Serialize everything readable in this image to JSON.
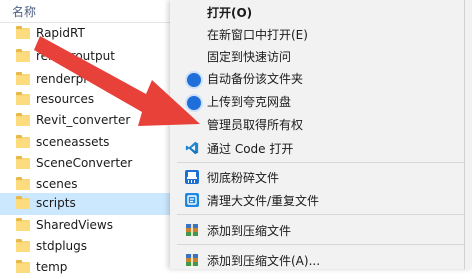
{
  "explorer": {
    "column_header": "名称",
    "files": [
      {
        "name": "RapidRT",
        "selected": false
      },
      {
        "name": "renderoutput",
        "selected": false
      },
      {
        "name": "renderpl",
        "selected": false
      },
      {
        "name": "resources",
        "selected": false
      },
      {
        "name": "Revit_converter",
        "selected": false
      },
      {
        "name": "sceneassets",
        "selected": false
      },
      {
        "name": "SceneConverter",
        "selected": false
      },
      {
        "name": "scenes",
        "selected": false
      },
      {
        "name": "scripts",
        "selected": true
      },
      {
        "name": "SharedViews",
        "selected": false
      },
      {
        "name": "stdplugs",
        "selected": false
      },
      {
        "name": "temp",
        "selected": false
      }
    ]
  },
  "context_menu": {
    "items": [
      {
        "label": "打开(O)",
        "icon": "none",
        "bold": true
      },
      {
        "label": "在新窗口中打开(E)",
        "icon": "none"
      },
      {
        "label": "固定到快速访问",
        "icon": "none"
      },
      {
        "label": "自动备份该文件夹",
        "icon": "baidu-backup-icon"
      },
      {
        "label": "上传到夸克网盘",
        "icon": "quark-upload-icon"
      },
      {
        "label": "管理员取得所有权",
        "icon": "none"
      },
      {
        "label": "通过 Code 打开",
        "icon": "vscode-icon"
      },
      {
        "label": "彻底粉碎文件",
        "icon": "shredder-icon"
      },
      {
        "label": "清理大文件/重复文件",
        "icon": "cleanup-icon"
      },
      {
        "label": "添加到压缩文件",
        "icon": "archive-icon"
      },
      {
        "label": "添加到压缩文件(A)...",
        "icon": "archive-icon"
      }
    ]
  },
  "colors": {
    "selection": "#cce8ff",
    "menu_background": "#f2f2f2",
    "arrow": "#e8413a",
    "accent_blue": "#1e6fd9"
  }
}
